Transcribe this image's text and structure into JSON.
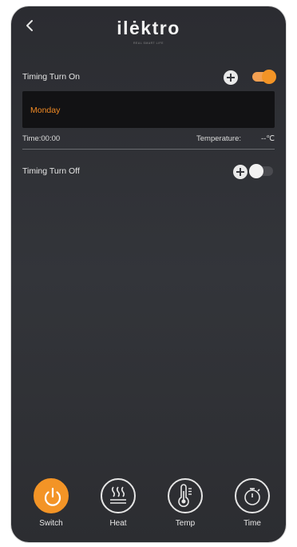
{
  "header": {
    "brand": "ilektro",
    "brand_display": "ilėktro",
    "tagline": "REAL SMART LIFE"
  },
  "timing_on": {
    "label": "Timing Turn On",
    "enabled": true
  },
  "schedule": {
    "day": "Monday",
    "time": "Time:00:00",
    "temperature_label": "Temperature:",
    "temperature_value": "--℃"
  },
  "timing_off": {
    "label": "Timing Turn Off",
    "enabled": false
  },
  "nav": {
    "items": [
      {
        "label": "Switch",
        "icon": "power-icon",
        "active": true
      },
      {
        "label": "Heat",
        "icon": "heat-icon",
        "active": false
      },
      {
        "label": "Temp",
        "icon": "thermometer-icon",
        "active": false
      },
      {
        "label": "Time",
        "icon": "stopwatch-icon",
        "active": false
      }
    ]
  },
  "colors": {
    "accent": "#f39426",
    "background": "#2e2f34",
    "panel": "#121214",
    "text": "#e6e6e6"
  }
}
